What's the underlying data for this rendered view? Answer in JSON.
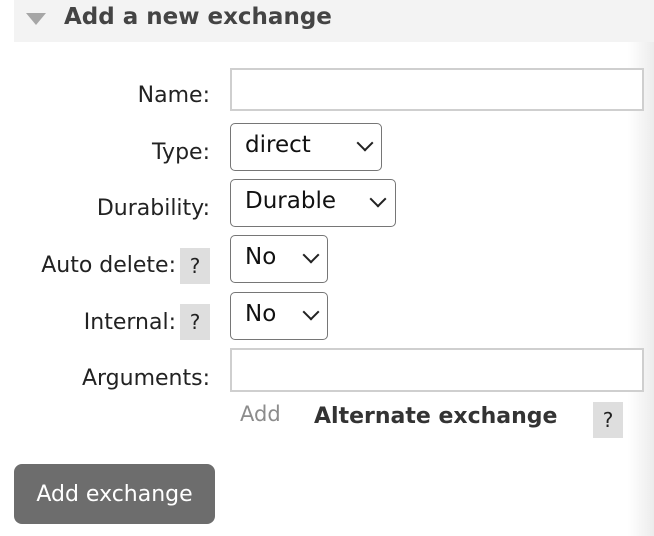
{
  "section": {
    "title": "Add a new exchange",
    "icon": "triangle-down-icon"
  },
  "form": {
    "name": {
      "label": "Name:",
      "value": "",
      "placeholder": ""
    },
    "type": {
      "label": "Type:",
      "selected": "direct"
    },
    "durability": {
      "label": "Durability:",
      "selected": "Durable"
    },
    "auto_delete": {
      "label": "Auto delete:",
      "selected": "No",
      "help": "?"
    },
    "internal": {
      "label": "Internal:",
      "selected": "No",
      "help": "?"
    },
    "arguments": {
      "label": "Arguments:",
      "value": "",
      "placeholder": ""
    },
    "add_link": "Add",
    "alternate_exchange": {
      "label": "Alternate exchange",
      "help": "?"
    }
  },
  "submit": {
    "label": "Add exchange"
  },
  "colors": {
    "header_bg": "#f3f3f3",
    "button_bg": "#6d6d6d",
    "help_bg": "#dedede",
    "link_gray": "#8c8c8c"
  }
}
